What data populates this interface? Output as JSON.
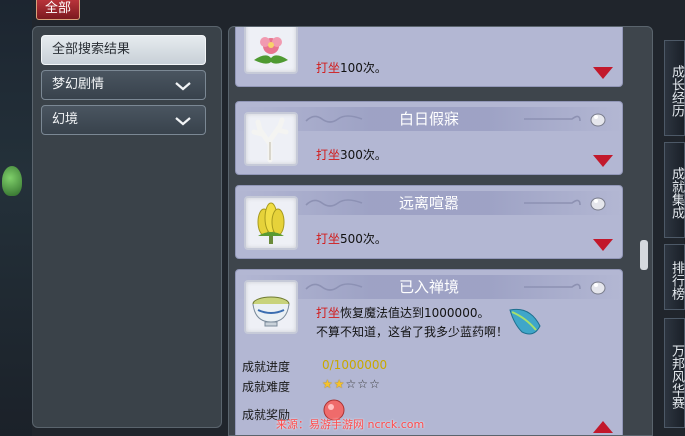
{
  "top_tab": "全部",
  "categories": [
    {
      "label": "全部搜索结果"
    },
    {
      "label": "梦幻剧情"
    },
    {
      "label": "幻境"
    }
  ],
  "achievements": [
    {
      "title": "",
      "keyword": "打坐",
      "desc_rest": "100次。",
      "icon": "flower-icon"
    },
    {
      "title": "白日假寐",
      "keyword": "打坐",
      "desc_rest": "300次。",
      "icon": "coral-icon"
    },
    {
      "title": "远离喧嚣",
      "keyword": "打坐",
      "desc_rest": "500次。",
      "icon": "banana-icon"
    },
    {
      "title": "已入禅境",
      "keyword": "打坐",
      "desc_rest": "恢复魔法值达到1000000。",
      "desc_line2": "不算不知道，这省了我多少蓝药啊！",
      "icon": "bowl-icon",
      "progress_label": "成就进度",
      "progress_value": "0/1000000",
      "difficulty_label": "成就难度",
      "difficulty_stars": 2,
      "difficulty_max": 5,
      "reward_label": "成就奖励"
    }
  ],
  "right_tabs": [
    {
      "label": "成长经历"
    },
    {
      "label": "成就集成"
    },
    {
      "label": "排行榜"
    },
    {
      "label": "万邦风华赛"
    }
  ],
  "watermark": "来源：易游手游网 ncrck.com",
  "colors": {
    "keyword": "#d21a1a",
    "card_bg": "#b3b7d3",
    "progress": "#c8a800",
    "star_on": "#f6c22a"
  }
}
